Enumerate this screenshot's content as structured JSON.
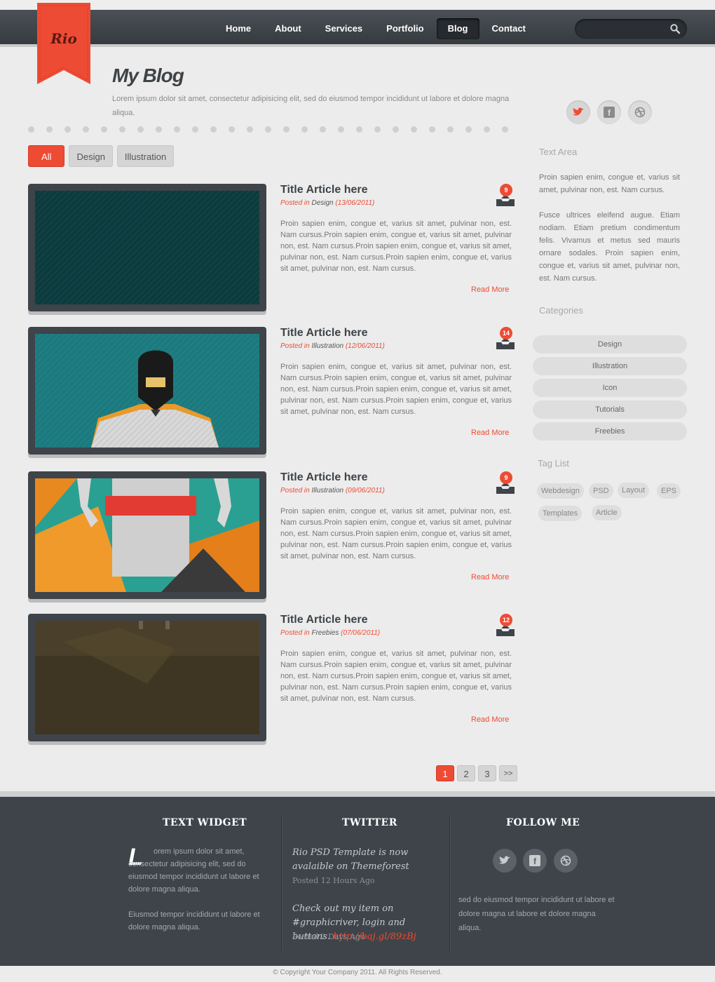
{
  "brand": {
    "logo_text": "Rio",
    "accent": "#ee4b34"
  },
  "nav": {
    "items": [
      "Home",
      "About",
      "Services",
      "Portfolio",
      "Blog",
      "Contact"
    ],
    "active": "Blog"
  },
  "search": {
    "placeholder": ""
  },
  "page": {
    "title": "My Blog",
    "intro": "Lorem ipsum dolor sit amet, consectetur adipisicing elit, sed do eiusmod tempor incididunt ut labore et dolore magna aliqua."
  },
  "filters": [
    "All",
    "Design",
    "Illustration"
  ],
  "posts": [
    {
      "title": "Title Article here",
      "posted_in": "Posted in",
      "category": "Design",
      "date": "(13/06/2011)",
      "comments": "9",
      "body": "Proin sapien enim, congue et, varius sit amet, pulvinar non, est. Nam cursus.Proin sapien enim, congue et, varius sit amet, pulvinar non, est. Nam cursus.Proin sapien enim, congue et, varius sit amet, pulvinar non, est. Nam cursus.Proin sapien enim, congue et, varius sit amet, pulvinar non, est. Nam cursus.",
      "read_more": "Read More"
    },
    {
      "title": "Title Article here",
      "posted_in": "Posted in",
      "category": "Illustration",
      "date": "(12/06/2011)",
      "comments": "14",
      "body": "Proin sapien enim, congue et, varius sit amet, pulvinar non, est. Nam cursus.Proin sapien enim, congue et, varius sit amet, pulvinar non, est. Nam cursus.Proin sapien enim, congue et, varius sit amet, pulvinar non, est. Nam cursus.Proin sapien enim, congue et, varius sit amet, pulvinar non, est. Nam cursus.",
      "read_more": "Read More"
    },
    {
      "title": "Title Article here",
      "posted_in": "Posted in",
      "category": "Illustration",
      "date": "(09/06/2011)",
      "comments": "9",
      "body": "Proin sapien enim, congue et, varius sit amet, pulvinar non, est. Nam cursus.Proin sapien enim, congue et, varius sit amet, pulvinar non, est. Nam cursus.Proin sapien enim, congue et, varius sit amet, pulvinar non, est. Nam cursus.Proin sapien enim, congue et, varius sit amet, pulvinar non, est. Nam cursus.",
      "read_more": "Read More"
    },
    {
      "title": "Title Article here",
      "posted_in": "Posted in",
      "category": "Freebies",
      "date": "(07/06/2011)",
      "comments": "12",
      "body": "Proin sapien enim, congue et, varius sit amet, pulvinar non, est. Nam cursus.Proin sapien enim, congue et, varius sit amet, pulvinar non, est. Nam cursus.Proin sapien enim, congue et, varius sit amet, pulvinar non, est. Nam cursus.Proin sapien enim, congue et, varius sit amet, pulvinar non, est. Nam cursus.",
      "read_more": "Read More"
    }
  ],
  "pagination": [
    "1",
    "2",
    "3",
    ">>"
  ],
  "sidebar": {
    "text_area_title": "Text Area",
    "text_p1": "Proin sapien enim, congue et, varius sit amet, pulvinar non, est. Nam cursus.",
    "text_p2": "Fusce ultrices eleifend augue. Etiam nodiam. Etiam pretium condimentum felis. Vivamus et metus sed mauris ornare sodales. Proin sapien enim, congue et, varius sit amet, pulvinar non, est. Nam cursus.",
    "categories_title": "Categories",
    "categories": [
      "Design",
      "Illustration",
      "Icon",
      "Tutorials",
      "Freebies"
    ],
    "tags_title": "Tag List",
    "tags": [
      "Webdesign",
      "PSD",
      "Layout",
      "EPS",
      "Templates",
      "Article"
    ],
    "social_icons": [
      "twitter-icon",
      "facebook-icon",
      "dribbble-icon"
    ]
  },
  "footer": {
    "text_widget_title": "TEXT WIDGET",
    "dropcap": "L",
    "text_widget_p1": "orem ipsum dolor sit amet, consectetur adipisicing elit, sed do eiusmod tempor incididunt ut labore et dolore magna aliqua.",
    "text_widget_p2": "Eiusmod tempor incididunt ut labore et dolore magna aliqua.",
    "twitter_title": "TWITTER",
    "tweet1": "Rio PSD Template is now avalaible on Themeforest",
    "tweet1_date": "Posted 12 Hours Ago",
    "tweet2_text": "Check out my item on #graphicriver, login and buttons.",
    "tweet2_link": "http://baj.gl/89zBj",
    "tweet2_date": "Posted 2 Days Ago",
    "follow_title": "FOLLOW ME",
    "follow_text": "sed do eiusmod tempor incididunt ut labore et dolore magna ut labore et dolore magna aliqua.",
    "copyright": "© Copyright Your Company 2011. All Rights Reserved."
  }
}
